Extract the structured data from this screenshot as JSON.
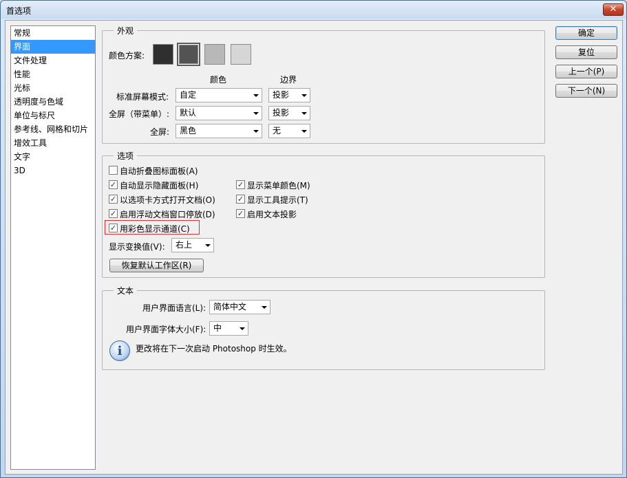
{
  "window": {
    "title": "首选项",
    "close_glyph": "✕"
  },
  "sidebar": {
    "items": [
      {
        "label": "常规",
        "selected": false
      },
      {
        "label": "界面",
        "selected": true
      },
      {
        "label": "文件处理",
        "selected": false
      },
      {
        "label": "性能",
        "selected": false
      },
      {
        "label": "光标",
        "selected": false
      },
      {
        "label": "透明度与色域",
        "selected": false
      },
      {
        "label": "单位与标尺",
        "selected": false
      },
      {
        "label": "参考线、网格和切片",
        "selected": false
      },
      {
        "label": "增效工具",
        "selected": false
      },
      {
        "label": "文字",
        "selected": false
      },
      {
        "label": "3D",
        "selected": false
      }
    ]
  },
  "appearance": {
    "legend": "外观",
    "color_scheme_label": "颜色方案:",
    "swatches": [
      "#2f2f2f",
      "#535353",
      "#b8b8b8",
      "#d6d6d6"
    ],
    "selected_swatch": 1,
    "col_color": "颜色",
    "col_border": "边界",
    "rows": [
      {
        "label": "标准屏幕模式:",
        "color": "自定",
        "border": "投影"
      },
      {
        "label": "全屏（带菜单）:",
        "color": "默认",
        "border": "投影"
      },
      {
        "label": "全屏:",
        "color": "黑色",
        "border": "无"
      }
    ]
  },
  "options": {
    "legend": "选项",
    "checkboxes": [
      {
        "label": "自动折叠图标面板(A)",
        "checked": false
      },
      {
        "label": "自动显示隐藏面板(H)",
        "checked": true
      },
      {
        "label": "以选项卡方式打开文档(O)",
        "checked": true
      },
      {
        "label": "启用浮动文档窗口停放(D)",
        "checked": true
      },
      {
        "label": "用彩色显示通道(C)",
        "checked": true
      },
      {
        "label": "显示菜单颜色(M)",
        "checked": true
      },
      {
        "label": "显示工具提示(T)",
        "checked": true
      },
      {
        "label": "启用文本投影",
        "checked": true
      }
    ],
    "transform_label": "显示变换值(V):",
    "transform_value": "右上",
    "reset_button": "恢复默认工作区(R)"
  },
  "text": {
    "legend": "文本",
    "ui_language_label": "用户界面语言(L):",
    "ui_language_value": "简体中文",
    "ui_font_size_label": "用户界面字体大小(F):",
    "ui_font_size_value": "中",
    "info_glyph": "i",
    "info_message": "更改将在下一次启动 Photoshop 时生效。"
  },
  "buttons": {
    "ok": "确定",
    "reset": "复位",
    "prev": "上一个(P)",
    "next": "下一个(N)"
  },
  "colors": {
    "selection": "#3399ff",
    "highlight_border": "#e03030"
  }
}
